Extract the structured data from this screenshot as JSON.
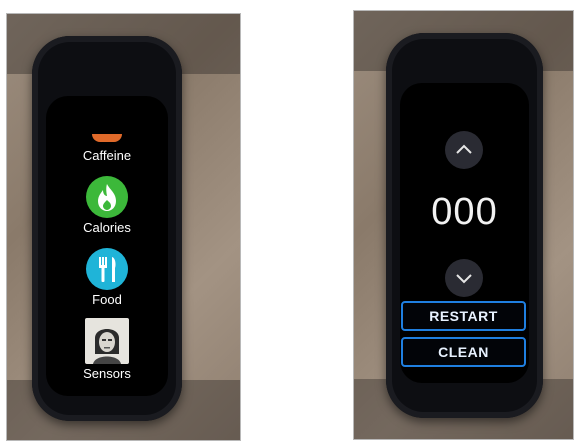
{
  "left_watch": {
    "apps": [
      {
        "label": "Caffeine",
        "icon": "caffeine-icon"
      },
      {
        "label": "Calories",
        "icon": "flame-icon",
        "color": "#3cb83a"
      },
      {
        "label": "Food",
        "icon": "fork-knife-icon",
        "color": "#1fb4d8"
      },
      {
        "label": "Sensors",
        "icon": "sensors-portrait-icon"
      }
    ]
  },
  "right_watch": {
    "counter_value": "000",
    "up_icon": "chevron-up-icon",
    "down_icon": "chevron-down-icon",
    "restart_label": "RESTART",
    "clean_label": "CLEAN",
    "accent_color": "#1f7fe0"
  }
}
